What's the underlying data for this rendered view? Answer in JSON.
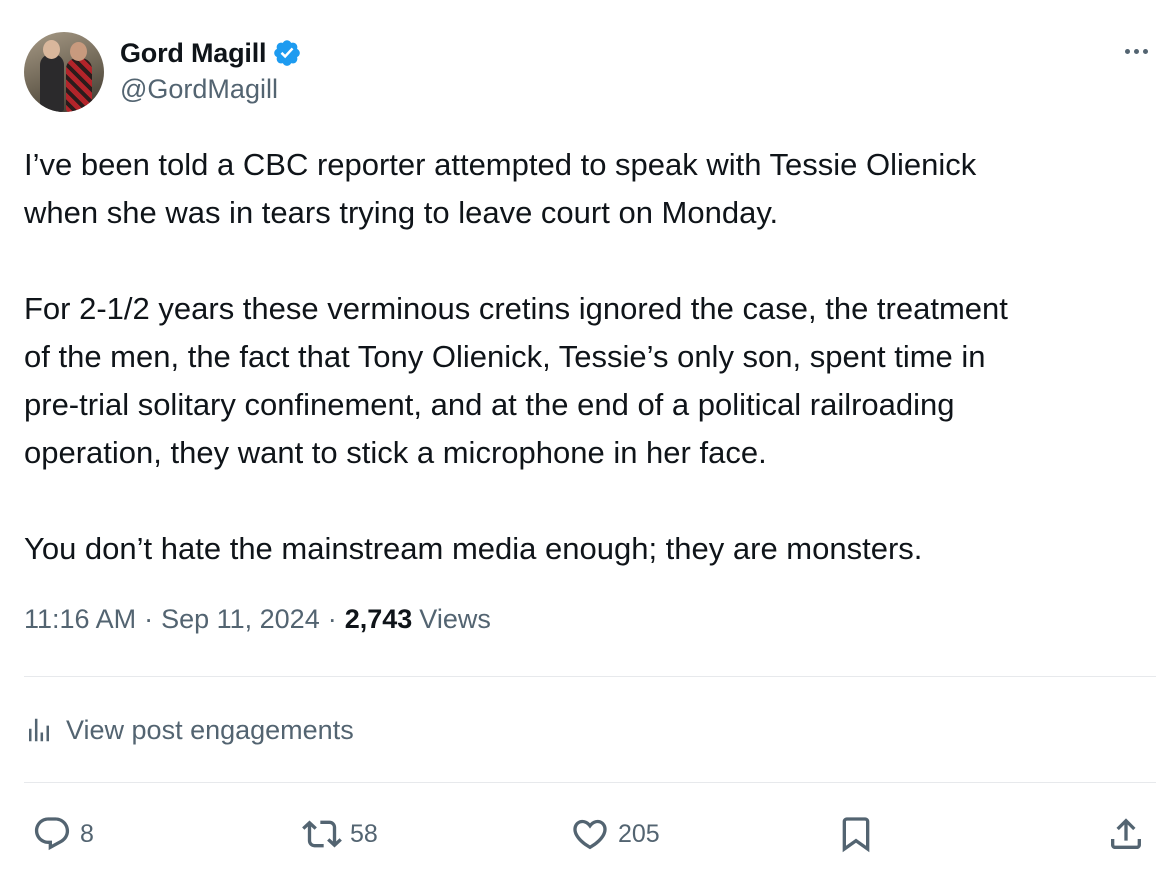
{
  "author": {
    "name": "Gord Magill",
    "handle": "@GordMagill",
    "verified": true,
    "verified_color": "#1d9bf0"
  },
  "body": {
    "paragraph_1": [
      "I’ve been told a CBC reporter attempted to speak with Tessie Olienick",
      "when she was in tears trying to leave court on Monday."
    ],
    "paragraph_2": [
      "For 2-1/2 years these verminous cretins ignored the case, the treatment",
      "of the men, the fact that Tony Olienick, Tessie’s only son, spent time in",
      "pre-trial solitary confinement, and at the end of a political railroading",
      "operation, they want to stick a microphone in her face."
    ],
    "paragraph_3": [
      "You don’t hate the mainstream media enough; they are monsters."
    ]
  },
  "meta": {
    "time": "11:16 AM",
    "separator": "·",
    "date": "Sep 11, 2024",
    "views_count": "2,743",
    "views_label": "Views"
  },
  "engagements_link": "View post engagements",
  "actions": {
    "replies": "8",
    "reposts": "58",
    "likes": "205"
  },
  "icons": {
    "more": "more-icon",
    "analytics": "analytics-icon",
    "reply": "reply-icon",
    "repost": "repost-icon",
    "like": "heart-icon",
    "bookmark": "bookmark-icon",
    "share": "share-icon"
  },
  "colors": {
    "text": "#0f1419",
    "secondary": "#536471",
    "divider": "#e7e9ec"
  }
}
